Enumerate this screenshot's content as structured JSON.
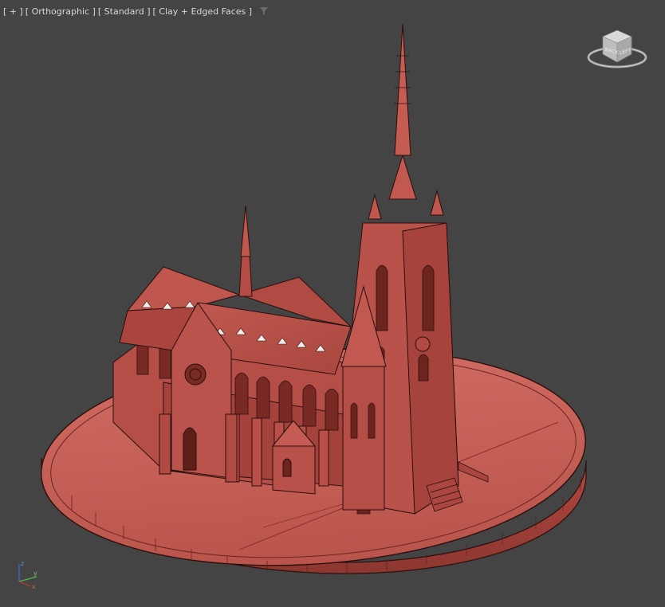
{
  "viewport": {
    "menu_plus": "[ + ]",
    "view_label": "[ Orthographic ]",
    "shading_style": "[ Standard ]",
    "display_mode": "[ Clay + Edged Faces ]",
    "filter_icon": "funnel-icon",
    "background_color": "#444444"
  },
  "viewcube": {
    "face_left": "BACK",
    "face_right": "LEFT",
    "icon": "viewcube-icon"
  },
  "axis_tripod": {
    "z_label": "z",
    "y_label": "y",
    "x_label": "x",
    "colors": {
      "x": "#c83a2a",
      "y": "#48b848",
      "z": "#3a6ee0"
    }
  },
  "scene": {
    "object": "cathedral-model",
    "clay_color": "#c85d55",
    "edge_color": "#2a0f0c"
  }
}
